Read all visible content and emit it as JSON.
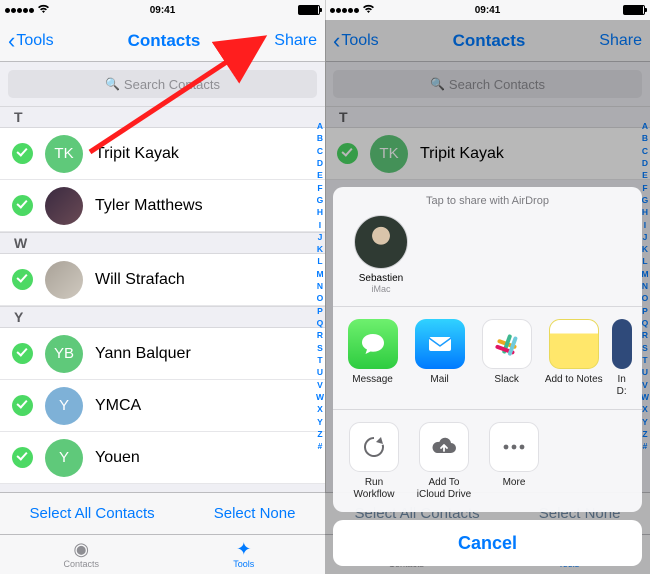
{
  "statusbar": {
    "time": "09:41"
  },
  "nav": {
    "back": "Tools",
    "title": "Contacts",
    "share": "Share"
  },
  "search": {
    "placeholder": "Search Contacts"
  },
  "sections": {
    "T": {
      "header": "T",
      "rows": [
        {
          "name": "Tripit Kayak",
          "initials": "TK",
          "avatar_kind": "initials-green"
        },
        {
          "name": "Tyler Matthews",
          "initials": "",
          "avatar_kind": "photo1"
        }
      ]
    },
    "W": {
      "header": "W",
      "rows": [
        {
          "name": "Will Strafach",
          "initials": "",
          "avatar_kind": "photo2"
        }
      ]
    },
    "Y": {
      "header": "Y",
      "rows": [
        {
          "name": "Yann Balquer",
          "initials": "YB",
          "avatar_kind": "initials-green"
        },
        {
          "name": "YMCA",
          "initials": "Y",
          "avatar_kind": "initials-blue"
        },
        {
          "name": "Youen",
          "initials": "Y",
          "avatar_kind": "initials-green"
        }
      ]
    }
  },
  "az_index": [
    "A",
    "B",
    "C",
    "D",
    "E",
    "F",
    "G",
    "H",
    "I",
    "J",
    "K",
    "L",
    "M",
    "N",
    "O",
    "P",
    "Q",
    "R",
    "S",
    "T",
    "U",
    "V",
    "W",
    "X",
    "Y",
    "Z",
    "#"
  ],
  "bottom": {
    "select_all": "Select All Contacts",
    "select_none": "Select None"
  },
  "tabs": {
    "contacts": "Contacts",
    "tools": "Tools"
  },
  "sheet": {
    "airdrop_title": "Tap to share with AirDrop",
    "airdrop": {
      "name": "Sebastien",
      "sub": "iMac"
    },
    "apps": [
      {
        "label": "Message",
        "icon": "message"
      },
      {
        "label": "Mail",
        "icon": "mail"
      },
      {
        "label": "Slack",
        "icon": "slack"
      },
      {
        "label": "Add to Notes",
        "icon": "notes"
      }
    ],
    "peek_app": {
      "label1": "In",
      "label2": "D:"
    },
    "actions": [
      {
        "label1": "Run",
        "label2": "Workflow",
        "icon": "sync"
      },
      {
        "label1": "Add To",
        "label2": "iCloud Drive",
        "icon": "cloud"
      },
      {
        "label1": "More",
        "label2": "",
        "icon": "more"
      }
    ],
    "cancel": "Cancel"
  }
}
